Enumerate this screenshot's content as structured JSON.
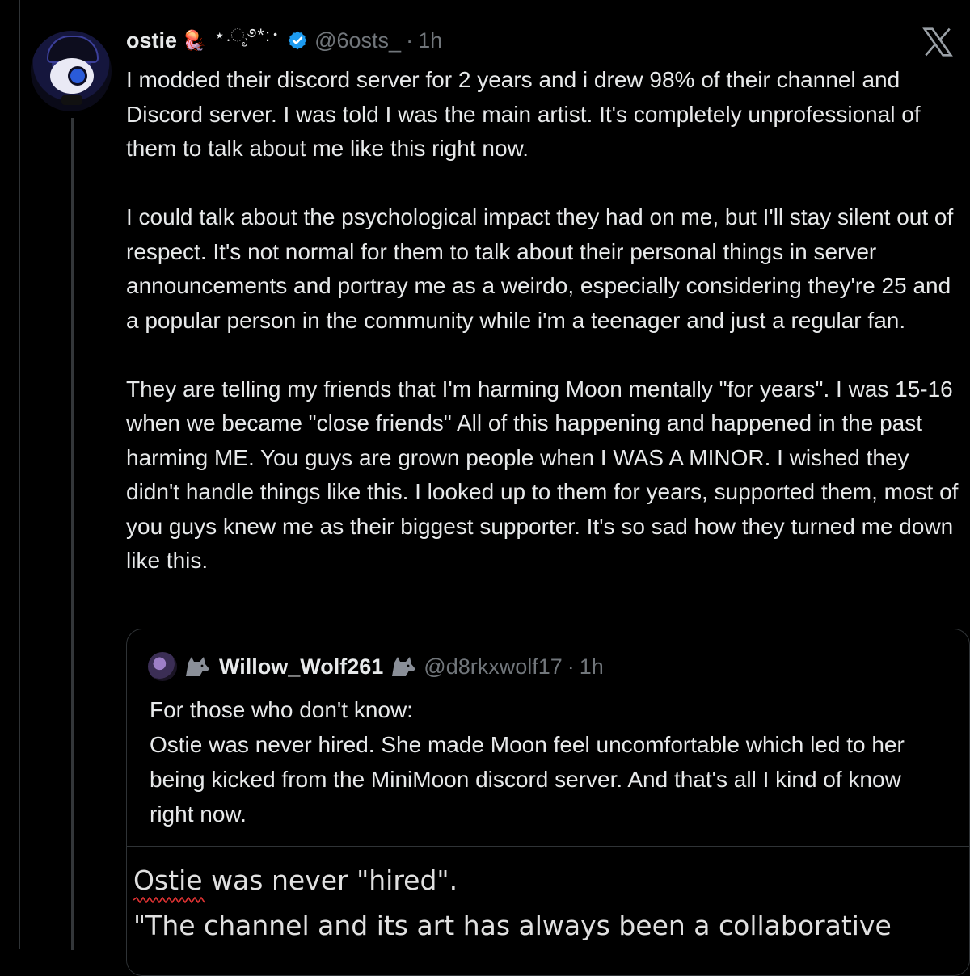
{
  "colors": {
    "background": "#000000",
    "text": "#e7e9ea",
    "secondary_text": "#71767b",
    "verified_badge": "#1d9bf0",
    "border": "#2f3336"
  },
  "tweet": {
    "author_name": "ostie",
    "name_emoji": "🪼",
    "name_decoration": "⋆.ೃ࿔*:･",
    "verified_icon": "verified-badge-icon",
    "handle": "@6osts_",
    "separator": "·",
    "time": "1h",
    "platform_icon": "x-logo-icon",
    "paragraphs": [
      "I modded their discord server for 2 years and i drew 98% of their channel and Discord server. I was told I was the main artist. It's completely unprofessional of them to talk about me like this right now.",
      "I could talk about the psychological impact they had on me, but I'll stay silent out of respect. It's not normal for them to talk about their personal things in server announcements and portray me as a weirdo, especially considering they're 25 and a popular person in the community while i'm a teenager and just a regular fan.",
      "They are telling my friends that I'm harming Moon mentally \"for years\". I was 15-16 when we became \"close friends\" All of this happening and happened in the past harming ME. You guys are grown people when I WAS A MINOR. I wished they didn't handle things like this. I looked up to them for years, supported them, most of you guys knew me as their biggest supporter. It's so sad how they turned me down like this."
    ]
  },
  "quoted": {
    "author_name": "Willow_Wolf261",
    "name_icon": "wolf-icon",
    "handle": "@d8rkxwolf17",
    "separator": "·",
    "time": "1h",
    "lines": [
      "For those who don't know:",
      "Ostie was never hired. She made Moon feel uncomfortable which led to her being kicked from the MiniMoon discord server. And that's all I kind of know right now."
    ],
    "image_text": {
      "line1": "Ostie was never \"hired\".",
      "line2": "\"The channel and its art has always been a collaborative"
    }
  }
}
